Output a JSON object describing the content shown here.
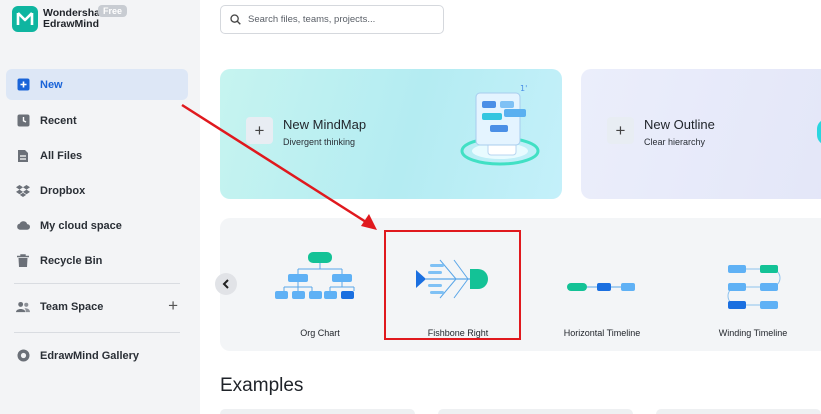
{
  "brand": {
    "line1": "Wondershare",
    "line2": "EdrawMind",
    "badge": "Free"
  },
  "sidebar": {
    "items": [
      {
        "label": "New"
      },
      {
        "label": "Recent"
      },
      {
        "label": "All Files"
      },
      {
        "label": "Dropbox"
      },
      {
        "label": "My cloud space"
      },
      {
        "label": "Recycle Bin"
      },
      {
        "label": "Team Space"
      },
      {
        "label": "EdrawMind Gallery"
      }
    ]
  },
  "search": {
    "placeholder": "Search files, teams, projects..."
  },
  "cards": [
    {
      "title": "New MindMap",
      "subtitle": "Divergent thinking"
    },
    {
      "title": "New Outline",
      "subtitle": "Clear hierarchy"
    }
  ],
  "templates": [
    {
      "label": "Org Chart"
    },
    {
      "label": "Fishbone Right"
    },
    {
      "label": "Horizontal Timeline"
    },
    {
      "label": "Winding Timeline"
    }
  ],
  "section": {
    "examples": "Examples"
  },
  "colors": {
    "accent": "#1a64d8",
    "brand": "#0fb5a0",
    "highlight": "#e0191e",
    "mindmap_card": "#b8eef2",
    "outline_card": "#e6e9f8"
  }
}
